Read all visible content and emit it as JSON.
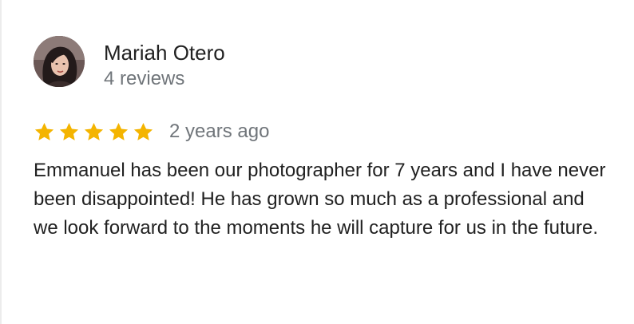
{
  "review": {
    "author": {
      "name": "Mariah Otero",
      "review_count": "4 reviews",
      "avatar_icon": "profile-photo"
    },
    "rating": {
      "value": 5,
      "max": 5,
      "star_color": "#f4b400",
      "star_icon": "star-icon"
    },
    "time_ago": "2 years ago",
    "text": "Emmanuel has been our photographer for 7 years and I have never been disappointed! He has grown so much as a professional and we look forward to the moments he will capture for us in the future."
  },
  "colors": {
    "name_text": "#212121",
    "meta_text": "#70757a",
    "body_text": "#212121",
    "background": "#ffffff"
  }
}
